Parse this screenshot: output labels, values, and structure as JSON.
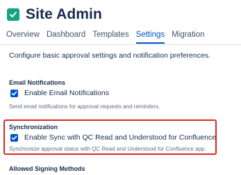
{
  "header": {
    "title": "Site Admin",
    "logo_icon": "check-icon",
    "logo_color": "#14a37f"
  },
  "tabs": [
    {
      "label": "Overview",
      "active": false
    },
    {
      "label": "Dashboard",
      "active": false
    },
    {
      "label": "Templates",
      "active": false
    },
    {
      "label": "Settings",
      "active": true
    },
    {
      "label": "Migration",
      "active": false
    }
  ],
  "intro": "Configure basic approval settings and notification preferences.",
  "email": {
    "title": "Email Notifications",
    "option_label": "Enable Email Notifications",
    "checked": true,
    "help": "Send email notifications for approval requests and reminders."
  },
  "sync": {
    "title": "Synchronization",
    "option_label": "Enable Sync with QC Read and Understood for Confluence",
    "checked": true,
    "help": "Synchronize approval status with QC Read and Understood for Confluence app.",
    "highlight_color": "#e2231a"
  },
  "signing": {
    "title": "Allowed Signing Methods"
  },
  "colors": {
    "accent": "#0052cc",
    "text": "#172b4d",
    "muted": "#5e6c84"
  }
}
